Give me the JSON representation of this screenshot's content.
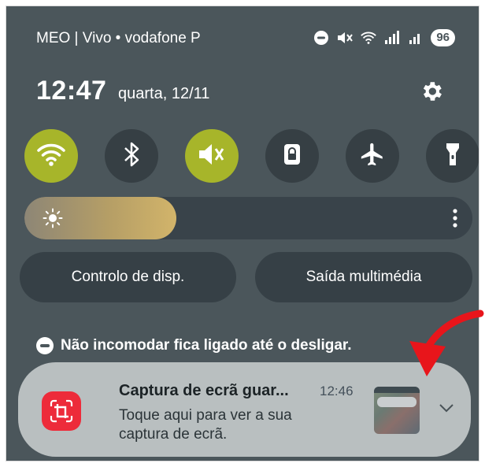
{
  "status_bar": {
    "carrier": "MEO | Vivo • vodafone P",
    "battery": "96",
    "icons": [
      "dnd-icon",
      "mute-icon",
      "wifi-icon",
      "signal-icon",
      "signal-icon"
    ]
  },
  "header": {
    "time": "12:47",
    "date": "quarta, 12/11",
    "settings_icon": "gear-icon"
  },
  "quick_tiles": [
    {
      "name": "wifi",
      "icon": "wifi-icon",
      "on": true
    },
    {
      "name": "bluetooth",
      "icon": "bluetooth-icon",
      "on": false
    },
    {
      "name": "sound",
      "icon": "mute-icon",
      "on": true
    },
    {
      "name": "screen-lock",
      "icon": "lock-icon",
      "on": false
    },
    {
      "name": "airplane",
      "icon": "airplane-icon",
      "on": false
    },
    {
      "name": "flashlight",
      "icon": "flashlight-icon",
      "on": false
    }
  ],
  "brightness": {
    "level_percent": 34,
    "icon": "sun-icon"
  },
  "buttons": {
    "device_control": "Controlo de disp.",
    "media_output": "Saída multimédia"
  },
  "dnd_notice": "Não incomodar fica ligado até o desligar.",
  "notification": {
    "title": "Captura de ecrã guar...",
    "time": "12:46",
    "body": "Toque aqui para ver a sua captura de ecrã.",
    "app_icon": "screenshot-icon",
    "expand_icon": "chevron-down-icon"
  },
  "colors": {
    "background": "#4b565b",
    "tile_on": "#a7b52a",
    "tile_off": "#363f44",
    "notification_bg": "#b9bfc0",
    "app_icon": "#ed2b3a",
    "annotation_arrow": "#e8151b"
  }
}
